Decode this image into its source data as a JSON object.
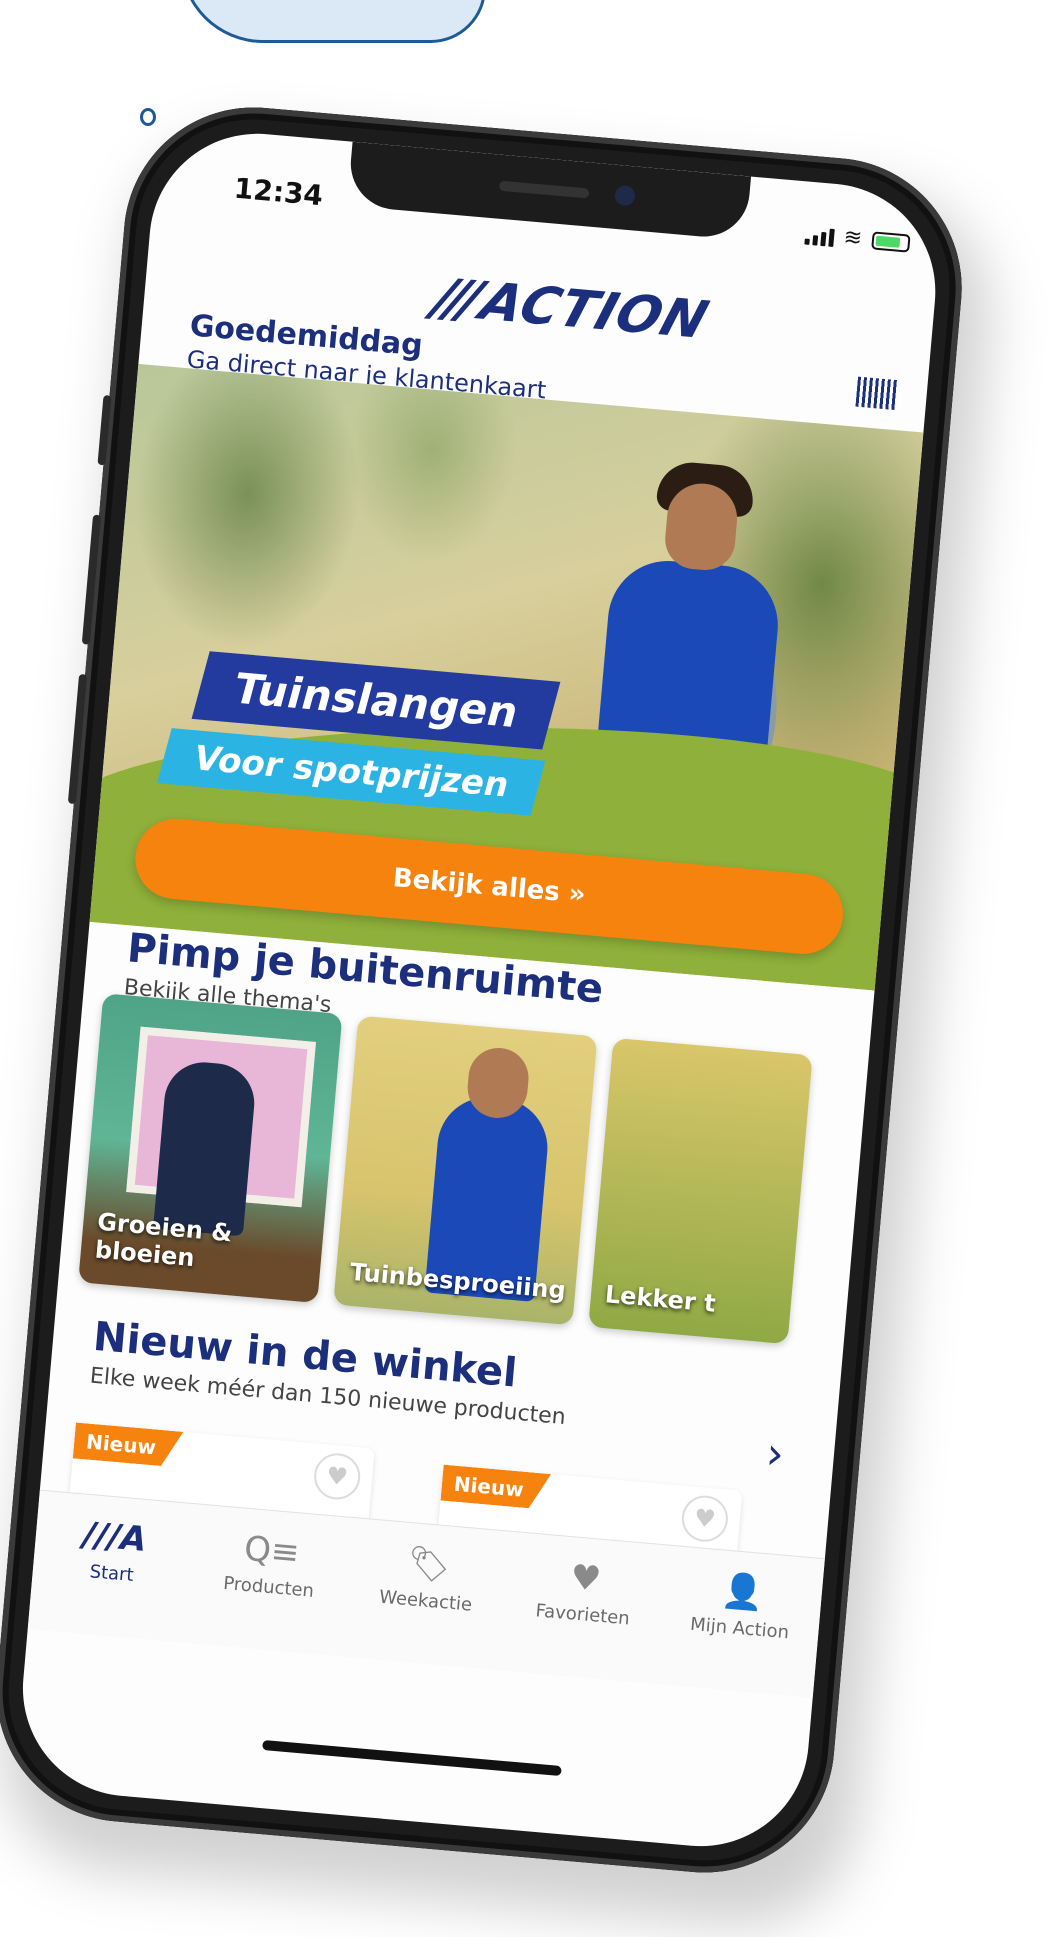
{
  "status_bar": {
    "time": "12:34"
  },
  "brand": {
    "logo_text": "ACTION",
    "logo_slashes": "///"
  },
  "greeting": {
    "title": "Goedemiddag",
    "subtitle": "Ga direct naar je klantenkaart"
  },
  "hero": {
    "title": "Tuinslangen",
    "subtitle": "Voor spotprijzen",
    "cta_label": "Bekijk alles »"
  },
  "themes": {
    "title": "Pimp je buitenruimte",
    "subtitle": "Bekijk alle thema's",
    "tiles": [
      {
        "label": "Groeien & bloeien"
      },
      {
        "label": "Tuinbesproeiing"
      },
      {
        "label": "Lekker t"
      }
    ]
  },
  "new_products": {
    "title": "Nieuw in de winkel",
    "subtitle": "Elke week méér dan 150 nieuwe producten",
    "badge": "Nieuw"
  },
  "tabbar": {
    "items": [
      {
        "label": "Start",
        "icon": "action-logo-icon",
        "glyph": "///A",
        "active": true
      },
      {
        "label": "Producten",
        "icon": "search-list-icon",
        "glyph": "Q≡",
        "active": false
      },
      {
        "label": "Weekactie",
        "icon": "tag-icon",
        "glyph": "🏷",
        "active": false
      },
      {
        "label": "Favorieten",
        "icon": "heart-icon",
        "glyph": "♥",
        "active": false
      },
      {
        "label": "Mijn Action",
        "icon": "user-icon",
        "glyph": "👤",
        "active": false
      }
    ]
  },
  "colors": {
    "brand_blue": "#1b2f7c",
    "cta_orange": "#f7830f",
    "banner_blue": "#233a9e",
    "banner_cyan": "#2bb4e3",
    "hero_green": "#8fb03a"
  }
}
